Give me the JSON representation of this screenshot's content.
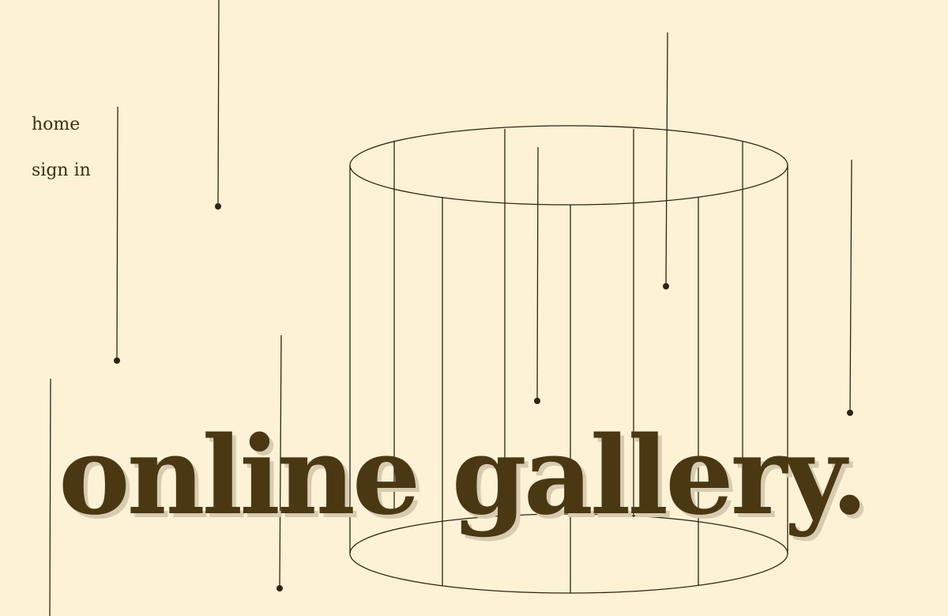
{
  "nav": {
    "home": "home",
    "sign_in": "sign in"
  },
  "hero": {
    "title": "online gallery."
  },
  "colors": {
    "background": "#fdf2d5",
    "ink": "#3d2f12",
    "title": "#4a3813",
    "title_shadow": "#d7cbb0"
  }
}
